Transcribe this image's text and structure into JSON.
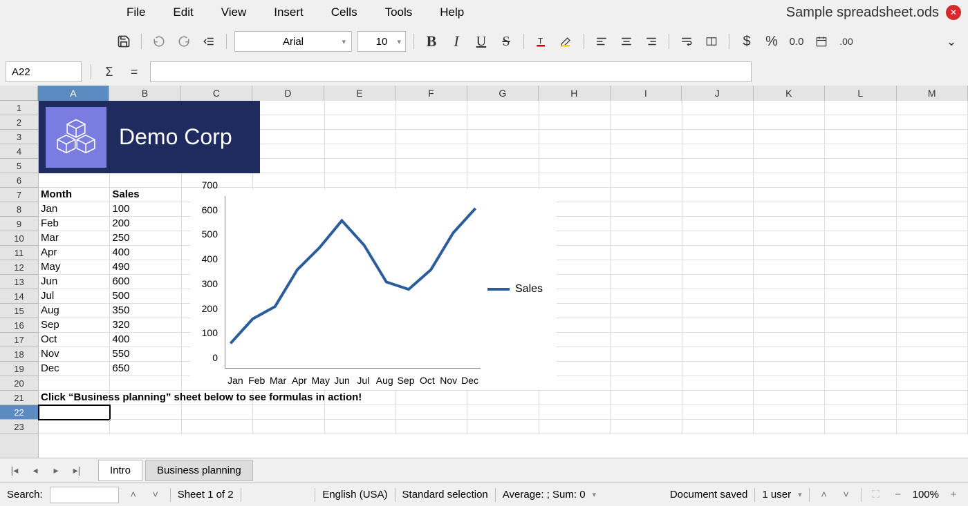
{
  "document_title": "Sample spreadsheet.ods",
  "menus": [
    "File",
    "Edit",
    "View",
    "Insert",
    "Cells",
    "Tools",
    "Help"
  ],
  "toolbar": {
    "font_name": "Arial",
    "font_size": "10",
    "currency_symbol": "$",
    "percent_symbol": "%",
    "decimal_fixed": "0.0",
    "decimal_add": ".00"
  },
  "formula_bar": {
    "cell_ref": "A22",
    "sigma": "Σ",
    "equals": "=",
    "formula": ""
  },
  "columns": [
    "A",
    "B",
    "C",
    "D",
    "E",
    "F",
    "G",
    "H",
    "I",
    "J",
    "K",
    "L",
    "M"
  ],
  "rows": [
    "1",
    "2",
    "3",
    "4",
    "5",
    "6",
    "7",
    "8",
    "9",
    "10",
    "11",
    "12",
    "13",
    "14",
    "15",
    "16",
    "17",
    "18",
    "19",
    "20",
    "21",
    "22",
    "23"
  ],
  "active_cell": "A22",
  "logo": {
    "company": "Demo Corp"
  },
  "table": {
    "header": {
      "a": "Month",
      "b": "Sales"
    },
    "rows": [
      {
        "month": "Jan",
        "sales": "100"
      },
      {
        "month": "Feb",
        "sales": "200"
      },
      {
        "month": "Mar",
        "sales": "250"
      },
      {
        "month": "Apr",
        "sales": "400"
      },
      {
        "month": "May",
        "sales": "490"
      },
      {
        "month": "Jun",
        "sales": "600"
      },
      {
        "month": "Jul",
        "sales": "500"
      },
      {
        "month": "Aug",
        "sales": "350"
      },
      {
        "month": "Sep",
        "sales": "320"
      },
      {
        "month": "Oct",
        "sales": "400"
      },
      {
        "month": "Nov",
        "sales": "550"
      },
      {
        "month": "Dec",
        "sales": "650"
      }
    ]
  },
  "instruction_row": "Click “Business planning” sheet below to see formulas in action!",
  "chart_data": {
    "type": "line",
    "title": "",
    "xlabel": "",
    "ylabel": "",
    "ylim": [
      0,
      700
    ],
    "y_ticks": [
      0,
      100,
      200,
      300,
      400,
      500,
      600,
      700
    ],
    "categories": [
      "Jan",
      "Feb",
      "Mar",
      "Apr",
      "May",
      "Jun",
      "Jul",
      "Aug",
      "Sep",
      "Oct",
      "Nov",
      "Dec"
    ],
    "series": [
      {
        "name": "Sales",
        "values": [
          100,
          200,
          250,
          400,
          490,
          600,
          500,
          350,
          320,
          400,
          550,
          650
        ],
        "color": "#2b5c9c"
      }
    ],
    "legend_position": "right"
  },
  "sheet_tabs": {
    "active": "Intro",
    "tabs": [
      "Intro",
      "Business planning"
    ]
  },
  "status": {
    "search_label": "Search:",
    "sheet_info": "Sheet 1 of 2",
    "language": "English (USA)",
    "selection_mode": "Standard selection",
    "aggregate": "Average: ; Sum: 0",
    "save_state": "Document saved",
    "users": "1 user",
    "zoom": "100%"
  }
}
